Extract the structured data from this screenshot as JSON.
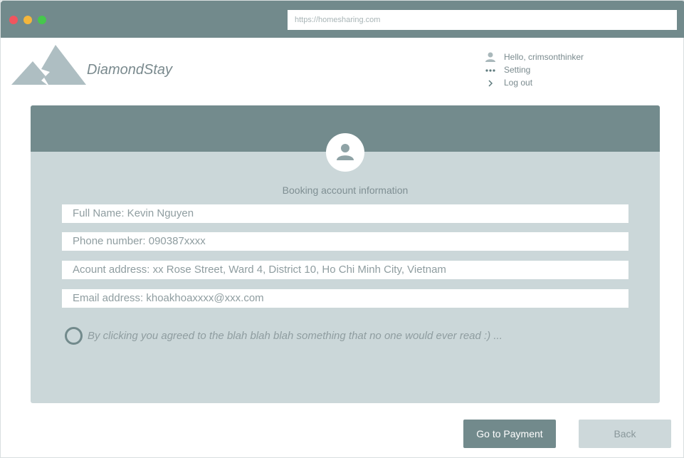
{
  "browser": {
    "url": "https://homesharing.com"
  },
  "header": {
    "brand": "DiamondStay",
    "user_menu": [
      {
        "label": "Hello, crimsonthinker",
        "icon": "user-icon"
      },
      {
        "label": "Setting",
        "icon": "more-dots-icon"
      },
      {
        "label": "Log out",
        "icon": "chevron-right-icon"
      }
    ]
  },
  "booking": {
    "title": "Booking account information",
    "fields": {
      "full_name": "Full Name: Kevin Nguyen",
      "phone": "Phone number: 090387xxxx",
      "address": "Acount address: xx Rose Street, Ward 4, District 10, Ho Chi Minh City, Vietnam",
      "email": "Email address: khoakhoaxxxx@xxx.com"
    },
    "agreement": "By clicking you agreed to the blah blah blah something that no one would ever read :) ..."
  },
  "actions": {
    "pay_label": "Go to Payment",
    "back_label": "Back"
  },
  "colors": {
    "header": "#728a8c",
    "panel": "#cbd7d9",
    "muted_text": "#7a8a8e",
    "close": "#f0555e",
    "minimize": "#f4b63b",
    "maximize": "#46c74c"
  }
}
